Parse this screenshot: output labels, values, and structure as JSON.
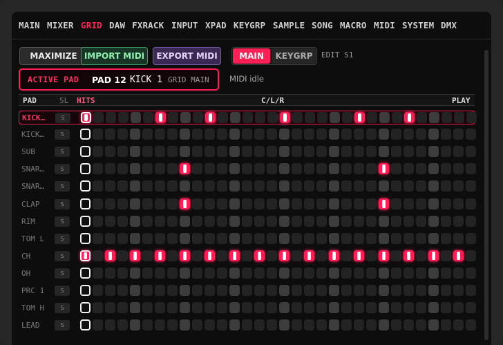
{
  "nav": [
    "MAIN",
    "MIXER",
    "GRID",
    "DAW",
    "FXRACK",
    "INPUT",
    "XPAD",
    "KEYGRP",
    "SAMPLE",
    "SONG",
    "MACRO",
    "MIDI",
    "SYSTEM",
    "DMX"
  ],
  "nav_active": "GRID",
  "toolbar": {
    "maximize": "MAXIMIZE",
    "import": "IMPORT MIDI",
    "export": "EXPORT MIDI",
    "mode_main": "MAIN",
    "mode_keygrp": "KEYGRP",
    "edit_label": "EDIT S1"
  },
  "active_pad": {
    "label": "ACTIVE PAD",
    "pad": "PAD 12",
    "name": "KICK 1",
    "grid": "GRID MAIN"
  },
  "midi_status": "MIDI idle",
  "grid_header": {
    "pad": "PAD",
    "sl": "SL",
    "hits": "HITS",
    "clr": "C/L/R",
    "play": "PLAY"
  },
  "solo_label": "S",
  "rows": [
    {
      "name": "KICK…",
      "active": true,
      "hits": [
        0,
        6,
        10,
        16,
        22,
        26
      ]
    },
    {
      "name": "KICK…",
      "active": false,
      "hits": []
    },
    {
      "name": "SUB",
      "active": false,
      "hits": []
    },
    {
      "name": "SNAR…",
      "active": false,
      "hits": [
        8,
        24
      ]
    },
    {
      "name": "SNAR…",
      "active": false,
      "hits": []
    },
    {
      "name": "CLAP",
      "active": false,
      "hits": [
        8,
        24
      ]
    },
    {
      "name": "RIM",
      "active": false,
      "hits": []
    },
    {
      "name": "TOM L",
      "active": false,
      "hits": []
    },
    {
      "name": "CH",
      "active": false,
      "hits": [
        0,
        2,
        4,
        6,
        8,
        10,
        12,
        14,
        16,
        18,
        20,
        22,
        24,
        26,
        28,
        30
      ]
    },
    {
      "name": "OH",
      "active": false,
      "hits": []
    },
    {
      "name": "PRC 1",
      "active": false,
      "hits": []
    },
    {
      "name": "TOM H",
      "active": false,
      "hits": []
    },
    {
      "name": "LEAD",
      "active": false,
      "hits": []
    }
  ],
  "steps": 32,
  "cursor_step": 0,
  "accent": "#ff1f57"
}
